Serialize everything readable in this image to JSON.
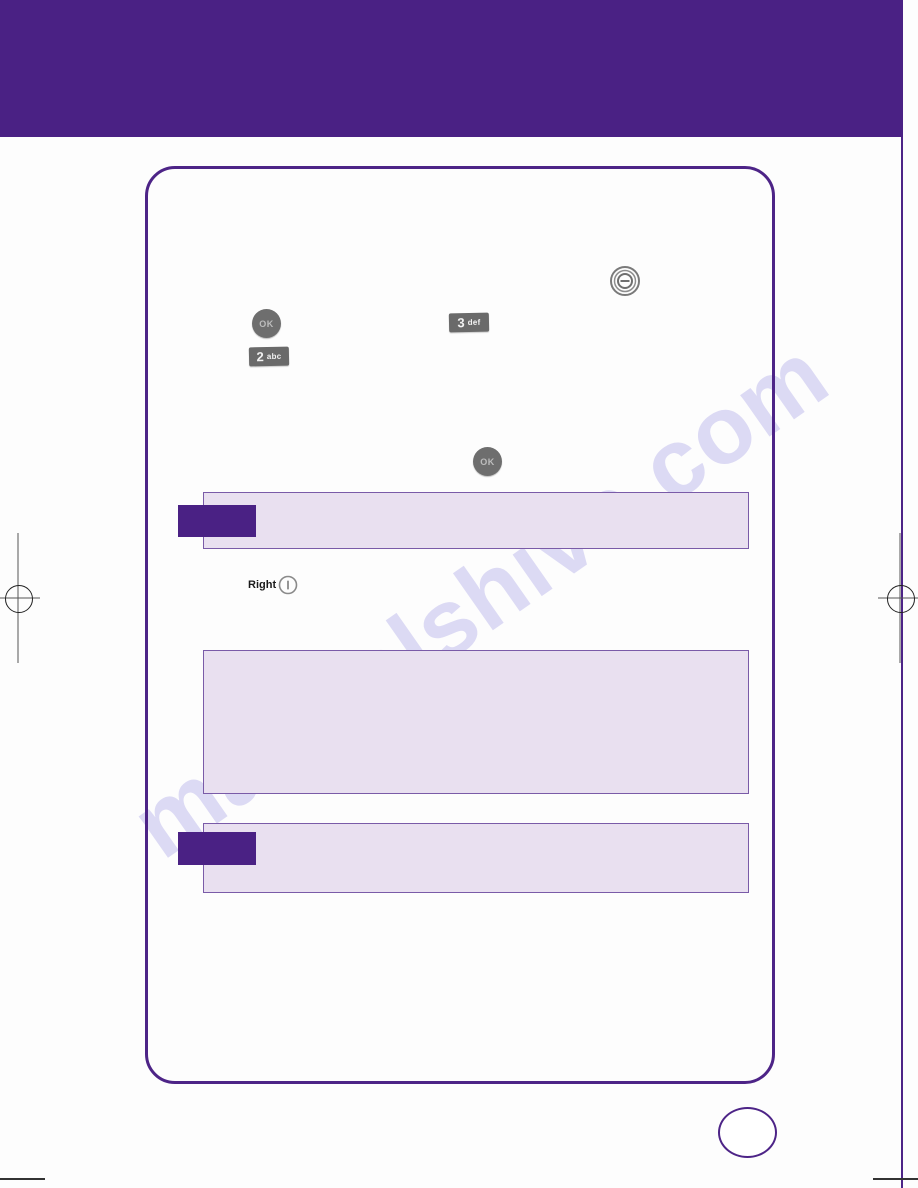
{
  "page": {
    "header_title": "",
    "page_number": "",
    "watermark": "manualshive.com"
  },
  "keys": [
    {
      "id": "ok-key-top",
      "type": "round-key",
      "label": "OK"
    },
    {
      "id": "ok-key-mid",
      "type": "round-key",
      "label": "OK"
    },
    {
      "id": "key-2",
      "type": "keypad-key",
      "digit": "2",
      "letters": "abc"
    },
    {
      "id": "key-3",
      "type": "keypad-key",
      "digit": "3",
      "letters": "def"
    },
    {
      "id": "menu-key",
      "type": "ring-key",
      "label": ""
    },
    {
      "id": "right-soft-key",
      "type": "labeled-key",
      "label": "Right"
    }
  ],
  "note_boxes": [
    {
      "id": "note-1",
      "tab_label": "",
      "body": ""
    },
    {
      "id": "note-2",
      "tab_label": "",
      "body": ""
    },
    {
      "id": "note-3",
      "tab_label": "",
      "body": ""
    }
  ],
  "colors": {
    "brand_purple": "#4a2184",
    "frame_purple": "#4d2487",
    "note_fill": "#e9e0f0",
    "note_border": "#7a5ba8",
    "key_gray": "#6a6a6a",
    "watermark_blue": "#c9c6ef"
  }
}
